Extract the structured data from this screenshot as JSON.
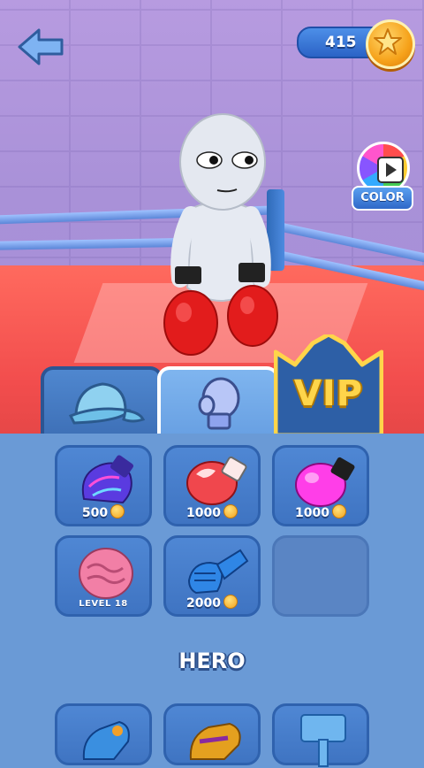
{
  "hud": {
    "coins": "415"
  },
  "color_button": {
    "label": "COLOR"
  },
  "tabs": [
    {
      "id": "hats",
      "icon": "cap-icon"
    },
    {
      "id": "gloves",
      "icon": "glove-icon",
      "selected": true
    },
    {
      "id": "vip",
      "label": "VIP"
    }
  ],
  "items": [
    {
      "name": "galaxy-glove",
      "price": "500",
      "currency": "coin"
    },
    {
      "name": "fire-glove",
      "price": "1000",
      "currency": "coin"
    },
    {
      "name": "pink-glove",
      "price": "1000",
      "currency": "coin"
    },
    {
      "name": "brain-glove",
      "unlock": "LEVEL 18"
    },
    {
      "name": "blue-gauntlet",
      "price": "2000",
      "currency": "coin"
    },
    {
      "name": "empty-slot"
    }
  ],
  "section": {
    "title": "HERO"
  },
  "hero_items": [
    {
      "name": "hero-glove-blue"
    },
    {
      "name": "hero-glove-gold"
    },
    {
      "name": "hero-hammer"
    }
  ],
  "colors": {
    "panel": "#6a9ad6",
    "slot": "#3f74c2",
    "coin": "#f6a21a",
    "vip": "#ffd54a"
  }
}
